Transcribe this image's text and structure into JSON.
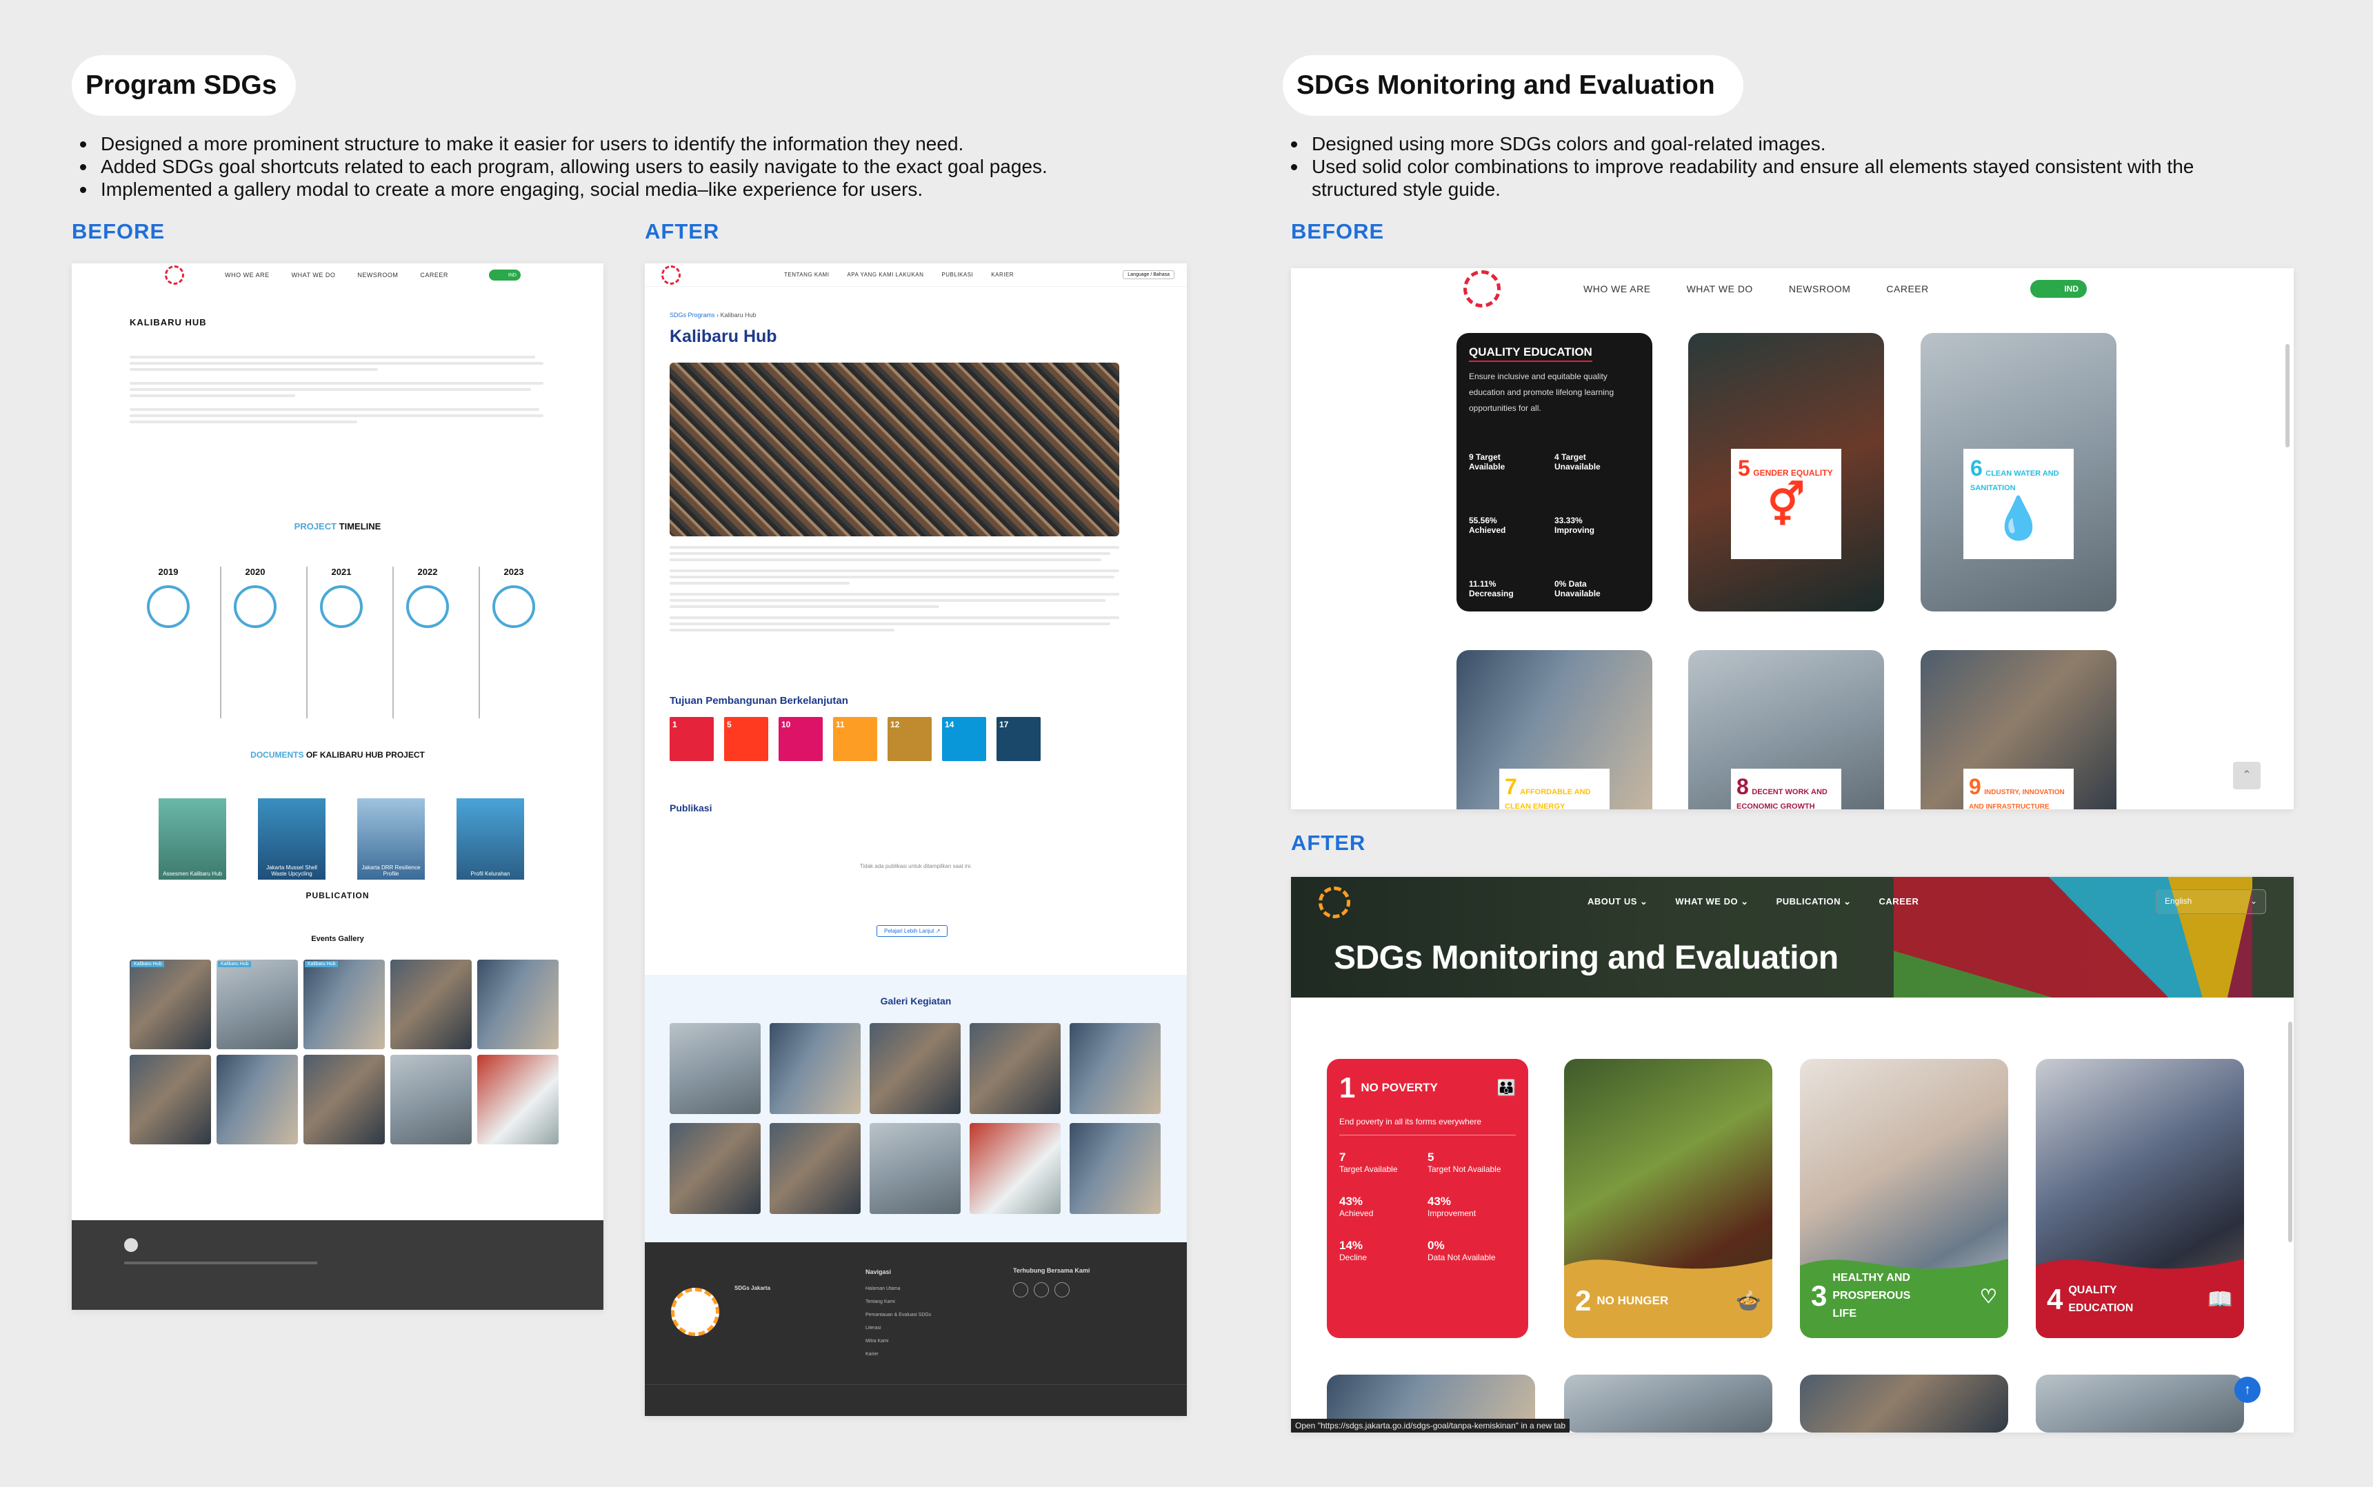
{
  "left_section": {
    "title": "Program SDGs",
    "bullets": [
      "Designed a more prominent structure to make it easier for users to identify the information they need.",
      "Added SDGs goal shortcuts related to each program, allowing users to easily navigate to the exact goal pages.",
      "Implemented a gallery modal to create a more engaging, social media–like experience for users."
    ],
    "before_label": "BEFORE",
    "after_label": "AFTER"
  },
  "right_section": {
    "title": "SDGs Monitoring and Evaluation",
    "bullets": [
      "Designed using more SDGs colors and goal-related images.",
      "Used solid color combinations to improve readability and ensure all elements stayed consistent with the structured style guide."
    ],
    "before_label": "BEFORE",
    "after_label": "AFTER"
  },
  "before_left": {
    "nav": [
      "WHO WE ARE",
      "WHAT WE DO",
      "NEWSROOM",
      "CAREER"
    ],
    "lang": "IND",
    "page_title": "KALIBARU HUB",
    "timeline_title_a": "PROJECT",
    "timeline_title_b": " TIMELINE",
    "years": [
      "2019",
      "2020",
      "2021",
      "2022",
      "2023"
    ],
    "documents_title_a": "DOCUMENTS",
    "documents_title_b": " OF KALIBARU HUB PROJECT",
    "documents": [
      "Assesmen Kalibaru Hub",
      "Jakarta Mussel Shell Waste Upcycling",
      "Jakarta DRR Resilience Profile",
      "Profil Kelurahan"
    ],
    "publication": "PUBLICATION",
    "events_gallery": "Events Gallery",
    "gallery_tag": "Kalibaru Hub"
  },
  "after_left": {
    "nav": [
      "TENTANG KAMI",
      "APA YANG KAMI LAKUKAN",
      "PUBLIKASI",
      "KARIER"
    ],
    "lang_select": "Language / Bahasa",
    "breadcrumb_a": "SDGs Programs",
    "breadcrumb_b": "Kalibaru Hub",
    "page_title": "Kalibaru Hub",
    "sdg_section": "Tujuan Pembangunan Berkelanjutan",
    "sdg_numbers": [
      "1",
      "5",
      "10",
      "11",
      "12",
      "14",
      "17"
    ],
    "sdg_colors": [
      "#e5243b",
      "#ff3a21",
      "#dd1367",
      "#fd9d24",
      "#bf8b2e",
      "#0a97d9",
      "#19486a"
    ],
    "publication_title": "Publikasi",
    "no_publication": "Tidak ada publikasi untuk ditampilkan saat ini.",
    "learn_more": "Pelajari Lebih Lanjut",
    "gallery_title": "Galeri Kegiatan",
    "footer_nav_title": "Navigasi",
    "footer_nav": [
      "Halaman Utama",
      "Tentang Kami",
      "Pemantauan & Evaluasi SDGs",
      "Literasi",
      "Mitra Kami",
      "Karier"
    ],
    "footer_connect": "Terhubung Bersama Kami",
    "footer_org": "SDGs Jakarta"
  },
  "before_right": {
    "nav": [
      "WHO WE ARE",
      "WHAT WE DO",
      "NEWSROOM",
      "CAREER"
    ],
    "lang": "IND",
    "card1": {
      "title": "QUALITY EDUCATION",
      "desc": "Ensure inclusive and equitable quality education and promote lifelong learning opportunities for all.",
      "stats": [
        [
          "9 Target",
          "Available"
        ],
        [
          "4 Target",
          "Unavailable"
        ],
        [
          "55.56%",
          "Achieved"
        ],
        [
          "33.33%",
          "Improving"
        ],
        [
          "11.11%",
          "Decreasing"
        ],
        [
          "0% Data",
          "Unavailable"
        ]
      ]
    },
    "goal_cards": [
      {
        "num": "5",
        "label": "GENDER EQUALITY",
        "color": "#ff3a21"
      },
      {
        "num": "6",
        "label": "CLEAN WATER AND SANITATION",
        "color": "#26bde2"
      },
      {
        "num": "7",
        "label": "AFFORDABLE AND CLEAN ENERGY",
        "color": "#fcc30b"
      },
      {
        "num": "8",
        "label": "DECENT WORK AND ECONOMIC GROWTH",
        "color": "#a21942"
      },
      {
        "num": "9",
        "label": "INDUSTRY, INNOVATION AND INFRASTRUCTURE",
        "color": "#fd6925"
      }
    ]
  },
  "after_right": {
    "nav": [
      "ABOUT US",
      "WHAT WE DO",
      "PUBLICATION",
      "CAREER"
    ],
    "lang_select": "English",
    "hero_title": "SDGs Monitoring and Evaluation",
    "card1": {
      "num": "1",
      "title": "NO POVERTY",
      "desc": "End poverty in all its forms everywhere",
      "stats": [
        [
          "7",
          "Target Available"
        ],
        [
          "5",
          "Target Not Available"
        ],
        [
          "43%",
          "Achieved"
        ],
        [
          "43%",
          "Improvement"
        ],
        [
          "14%",
          "Decline"
        ],
        [
          "0%",
          "Data Not Available"
        ]
      ]
    },
    "goal_cards": [
      {
        "num": "2",
        "label": "NO HUNGER",
        "color": "#dda63a"
      },
      {
        "num": "3",
        "label": "HEALTHY AND PROSPEROUS LIFE",
        "color": "#4c9f38"
      },
      {
        "num": "4",
        "label": "QUALITY EDUCATION",
        "color": "#c5192d"
      }
    ],
    "status_bar": "Open \"https://sdgs.jakarta.go.id/sdgs-goal/tanpa-kemiskinan\" in a new tab"
  }
}
